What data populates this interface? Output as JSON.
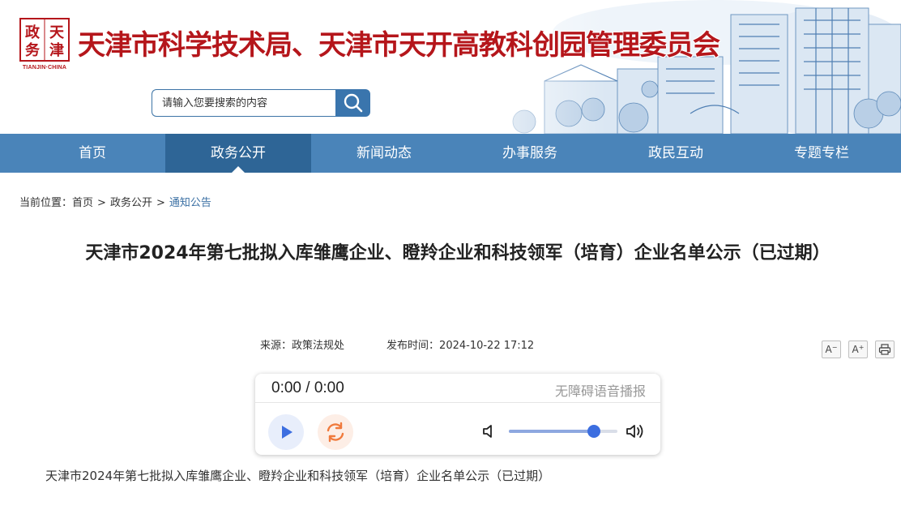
{
  "header": {
    "logo_text_en": "TIANJIN·CHINA",
    "logo_text_zh": "天津政务网",
    "site_title": "天津市科学技术局、天津市天开高教科创园管理委员会"
  },
  "search": {
    "placeholder": "请输入您要搜索的内容",
    "icon": "search-icon"
  },
  "nav": {
    "items": [
      {
        "label": "首页"
      },
      {
        "label": "政务公开"
      },
      {
        "label": "新闻动态"
      },
      {
        "label": "办事服务"
      },
      {
        "label": "政民互动"
      },
      {
        "label": "专题专栏"
      }
    ],
    "active_index": 1
  },
  "breadcrumb": {
    "prefix": "当前位置：",
    "items": [
      "首页",
      "政务公开",
      "通知公告"
    ],
    "separator": ">"
  },
  "article": {
    "title": "天津市2024年第七批拟入库雏鹰企业、瞪羚企业和科技领军（培育）企业名单公示（已过期）",
    "source_label": "来源：",
    "source": "政策法规处",
    "time_label": "发布时间：",
    "time": "2024-10-22 17:12",
    "body": "天津市2024年第七批拟入库雏鹰企业、瞪羚企业和科技领军（培育）企业名单公示（已过期）"
  },
  "tools": {
    "font_decrease": "A",
    "font_increase": "A",
    "print_icon": "print-icon"
  },
  "player": {
    "time": "0:00 / 0:00",
    "label": "无障碍语音播报",
    "volume": 0.78
  },
  "colors": {
    "brand_red": "#b5161b",
    "nav_blue": "#4a84b9",
    "nav_active": "#2e6596"
  }
}
